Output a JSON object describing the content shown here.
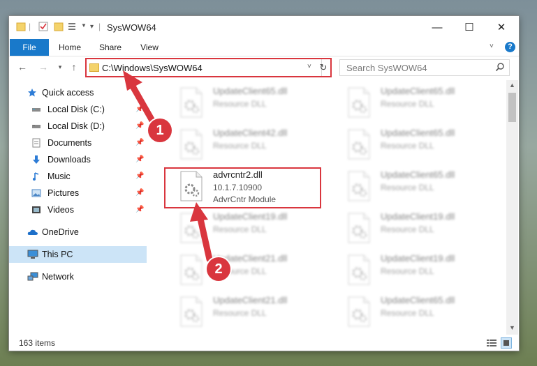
{
  "window": {
    "title": "SysWOW64",
    "controls": {
      "minimize": "—",
      "maximize": "☐",
      "close": "✕"
    }
  },
  "ribbon": {
    "tabs": [
      "File",
      "Home",
      "Share",
      "View"
    ],
    "help_label": "?"
  },
  "address_bar": {
    "path": "C:\\Windows\\SysWOW64",
    "search_placeholder": "Search SysWOW64"
  },
  "sidebar": {
    "items": [
      {
        "label": "Quick access",
        "icon": "star-icon"
      },
      {
        "label": "Local Disk (C:)",
        "icon": "drive-icon",
        "pinned": true
      },
      {
        "label": "Local Disk (D:)",
        "icon": "drive-icon",
        "pinned": true
      },
      {
        "label": "Documents",
        "icon": "documents-icon",
        "pinned": true
      },
      {
        "label": "Downloads",
        "icon": "downloads-icon",
        "pinned": true
      },
      {
        "label": "Music",
        "icon": "music-icon",
        "pinned": true
      },
      {
        "label": "Pictures",
        "icon": "pictures-icon",
        "pinned": true
      },
      {
        "label": "Videos",
        "icon": "videos-icon",
        "pinned": true
      },
      {
        "label": "OneDrive",
        "icon": "cloud-icon"
      },
      {
        "label": "This PC",
        "icon": "computer-icon",
        "selected": true
      },
      {
        "label": "Network",
        "icon": "network-icon"
      }
    ]
  },
  "files": [
    {
      "name": "UpdateClient65.dll",
      "type": "Resource DLL",
      "blurred": true
    },
    {
      "name": "UpdateClient65.dll",
      "type": "Resource DLL",
      "blurred": true
    },
    {
      "name": "UpdateClient42.dll",
      "type": "Resource DLL",
      "blurred": true
    },
    {
      "name": "UpdateClient65.dll",
      "type": "Resource DLL",
      "blurred": true
    },
    {
      "name": "advrcntr2.dll",
      "version": "10.1.7.10900",
      "type": "AdvrCntr Module",
      "blurred": false,
      "highlighted": true
    },
    {
      "name": "UpdateClient65.dll",
      "type": "Resource DLL",
      "blurred": true
    },
    {
      "name": "UpdateClient19.dll",
      "type": "Resource DLL",
      "blurred": true
    },
    {
      "name": "UpdateClient19.dll",
      "type": "Resource DLL",
      "blurred": true
    },
    {
      "name": "UpdateClient21.dll",
      "type": "Resource DLL",
      "blurred": true
    },
    {
      "name": "UpdateClient19.dll",
      "type": "Resource DLL",
      "blurred": true
    },
    {
      "name": "UpdateClient21.dll",
      "type": "Resource DLL",
      "blurred": true
    },
    {
      "name": "UpdateClient65.dll",
      "type": "Resource DLL",
      "blurred": true
    }
  ],
  "status": {
    "item_count": "163 items"
  },
  "callouts": [
    "1",
    "2"
  ],
  "colors": {
    "accent": "#1979ca",
    "highlight": "#d9363e",
    "selection": "#cce4f7"
  }
}
